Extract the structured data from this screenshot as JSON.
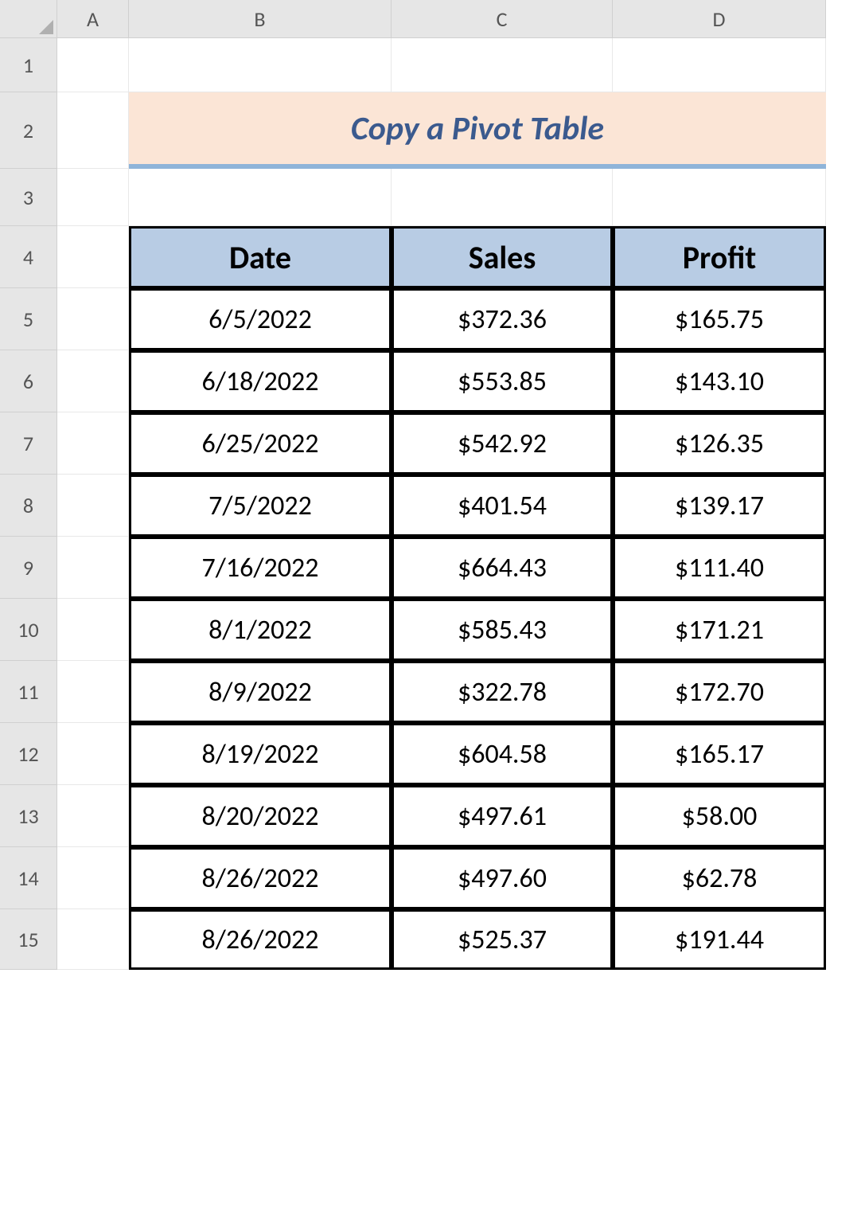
{
  "columns": {
    "A": "A",
    "B": "B",
    "C": "C",
    "D": "D"
  },
  "rows": [
    "1",
    "2",
    "3",
    "4",
    "5",
    "6",
    "7",
    "8",
    "9",
    "10",
    "11",
    "12",
    "13",
    "14",
    "15"
  ],
  "title": "Copy a Pivot Table",
  "table": {
    "headers": {
      "date": "Date",
      "sales": "Sales",
      "profit": "Profit"
    },
    "rows": [
      {
        "date": "6/5/2022",
        "sales": "$372.36",
        "profit": "$165.75"
      },
      {
        "date": "6/18/2022",
        "sales": "$553.85",
        "profit": "$143.10"
      },
      {
        "date": "6/25/2022",
        "sales": "$542.92",
        "profit": "$126.35"
      },
      {
        "date": "7/5/2022",
        "sales": "$401.54",
        "profit": "$139.17"
      },
      {
        "date": "7/16/2022",
        "sales": "$664.43",
        "profit": "$111.40"
      },
      {
        "date": "8/1/2022",
        "sales": "$585.43",
        "profit": "$171.21"
      },
      {
        "date": "8/9/2022",
        "sales": "$322.78",
        "profit": "$172.70"
      },
      {
        "date": "8/19/2022",
        "sales": "$604.58",
        "profit": "$165.17"
      },
      {
        "date": "8/20/2022",
        "sales": "$497.61",
        "profit": "$58.00"
      },
      {
        "date": "8/26/2022",
        "sales": "$497.60",
        "profit": "$62.78"
      },
      {
        "date": "8/26/2022",
        "sales": "$525.37",
        "profit": "$191.44"
      }
    ]
  }
}
